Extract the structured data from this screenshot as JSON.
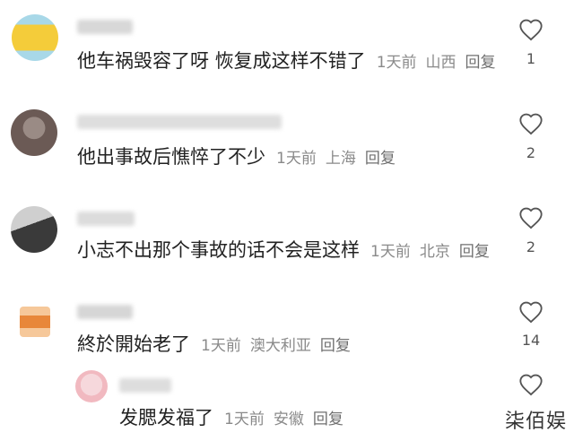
{
  "comments": [
    {
      "text": "他车祸毁容了呀 恢复成这样不错了",
      "time": "1天前",
      "location": "山西",
      "reply_label": "回复",
      "likes": "1",
      "avatar_colors": [
        "#f4cc3a",
        "#a8d8e8"
      ]
    },
    {
      "text": "他出事故后憔悴了不少",
      "time": "1天前",
      "location": "上海",
      "reply_label": "回复",
      "likes": "2",
      "avatar_colors": [
        "#6b5a55",
        "#9a8b85"
      ]
    },
    {
      "text": "小志不出那个事故的话不会是这样",
      "time": "1天前",
      "location": "北京",
      "reply_label": "回复",
      "likes": "2",
      "avatar_colors": [
        "#3a3a3a",
        "#cfcfcf"
      ]
    },
    {
      "text": "終於開始老了",
      "time": "1天前",
      "location": "澳大利亚",
      "reply_label": "回复",
      "likes": "14",
      "avatar_colors": [
        "#e8873a",
        "#f6c89a"
      ]
    },
    {
      "text": "发腮发福了",
      "time": "1天前",
      "location": "安徽",
      "reply_label": "回复",
      "likes": "",
      "avatar_colors": [
        "#f6d8dc",
        "#f1b9c0"
      ]
    }
  ],
  "watermark": "柒佰娱"
}
